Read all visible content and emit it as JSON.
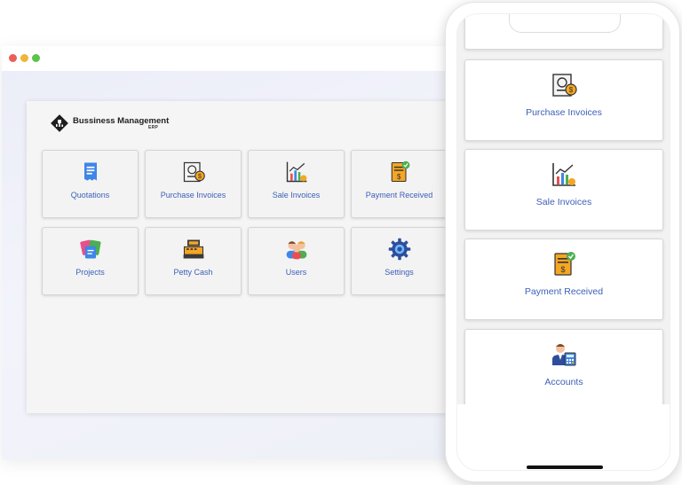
{
  "brand": {
    "name": "Bussiness Management",
    "subtitle": "ERP"
  },
  "desktop": {
    "modules": [
      {
        "label": "Quotations",
        "icon": "receipt-icon"
      },
      {
        "label": "Purchase Invoices",
        "icon": "purchase-invoice-icon"
      },
      {
        "label": "Sale Invoices",
        "icon": "chart-icon"
      },
      {
        "label": "Payment Received",
        "icon": "payment-receipt-icon"
      },
      {
        "label": "Projects",
        "icon": "projects-icon"
      },
      {
        "label": "Petty Cash",
        "icon": "cash-register-icon"
      },
      {
        "label": "Users",
        "icon": "users-icon"
      },
      {
        "label": "Settings",
        "icon": "gear-icon"
      }
    ]
  },
  "mobile": {
    "modules": [
      {
        "label": "Purchase Invoices",
        "icon": "purchase-invoice-icon"
      },
      {
        "label": "Sale Invoices",
        "icon": "chart-icon"
      },
      {
        "label": "Payment Received",
        "icon": "payment-receipt-icon"
      },
      {
        "label": "Accounts",
        "icon": "accountant-icon"
      }
    ]
  },
  "colors": {
    "label": "#3d60b8",
    "accent_orange": "#f5a623",
    "accent_green": "#4caf50"
  }
}
